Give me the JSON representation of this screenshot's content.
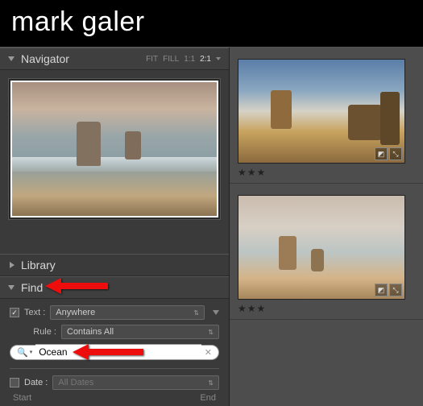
{
  "brand": "mark galer",
  "navigator": {
    "title": "Navigator",
    "modes": {
      "fit": "FIT",
      "fill": "FILL",
      "one": "1:1",
      "two": "2:1"
    }
  },
  "library": {
    "title": "Library"
  },
  "find": {
    "title": "Find",
    "text_label": "Text :",
    "text_scope": "Anywhere",
    "rule_label": "Rule :",
    "rule_value": "Contains All",
    "search_value": "Ocean",
    "date_label": "Date :",
    "date_value": "All Dates",
    "start_label": "Start",
    "end_label": "End"
  },
  "thumbs": {
    "rating": "★★★"
  }
}
